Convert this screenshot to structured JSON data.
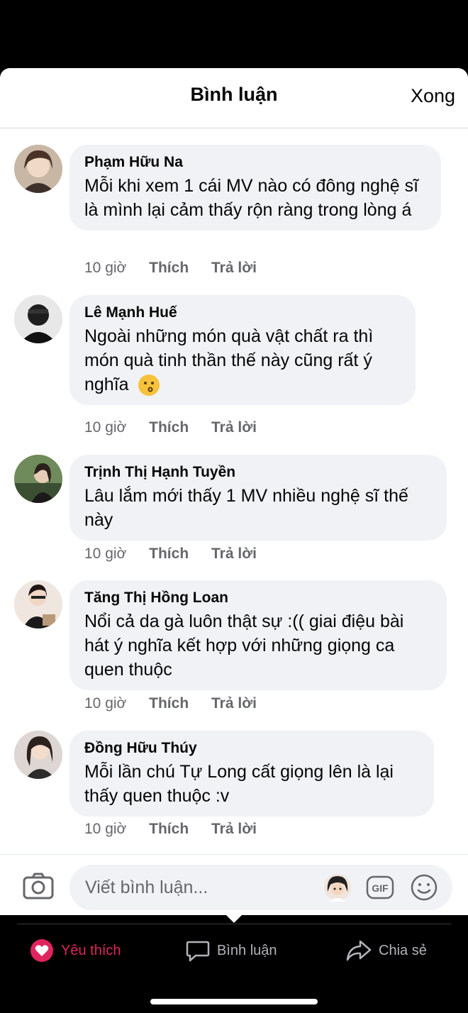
{
  "header": {
    "title": "Bình luận",
    "done": "Xong"
  },
  "comments": [
    {
      "name": "Phạm Hữu Na",
      "text": "Mỗi khi xem 1 cái MV nào có đông nghệ sĩ là mình lại cảm thấy rộn ràng trong lòng á",
      "time": "10 giờ",
      "like": "Thích",
      "reply": "Trả lời"
    },
    {
      "name": "Lê Mạnh Huế",
      "text": "Ngoài những món quà vật chất ra thì món quà tinh thần thế này cũng rất ý nghĩa",
      "time": "10 giờ",
      "like": "Thích",
      "reply": "Trả lời",
      "emoji": "kissing-face-emoji"
    },
    {
      "name": "Trịnh Thị Hạnh Tuyền",
      "text": "Lâu lắm mới thấy 1 MV nhiều nghệ sĩ thế này",
      "time": "10 giờ",
      "like": "Thích",
      "reply": "Trả lời"
    },
    {
      "name": "Tăng Thị Hồng Loan",
      "text": "Nổi cả da gà luôn thật sự :(( giai điệu bài hát ý nghĩa kết hợp với những giọng ca quen thuộc",
      "time": "10 giờ",
      "like": "Thích",
      "reply": "Trả lời"
    },
    {
      "name": "Đồng Hữu Thúy",
      "text": "Mỗi lần chú Tự Long cất giọng lên là lại thấy quen thuộc :v",
      "time": "10 giờ",
      "like": "Thích",
      "reply": "Trả lời"
    }
  ],
  "composer": {
    "placeholder": "Viết bình luận...",
    "icons": [
      "camera-icon",
      "avatar-sticker-icon",
      "gif-icon",
      "smiley-icon"
    ],
    "gif_label": "GIF"
  },
  "bottom_bar": {
    "like": {
      "label": "Yêu thích",
      "color": "#e0245e",
      "icon": "heart-icon"
    },
    "comment": {
      "label": "Bình luận",
      "icon": "comment-icon"
    },
    "share": {
      "label": "Chia sẻ",
      "icon": "share-icon"
    }
  }
}
